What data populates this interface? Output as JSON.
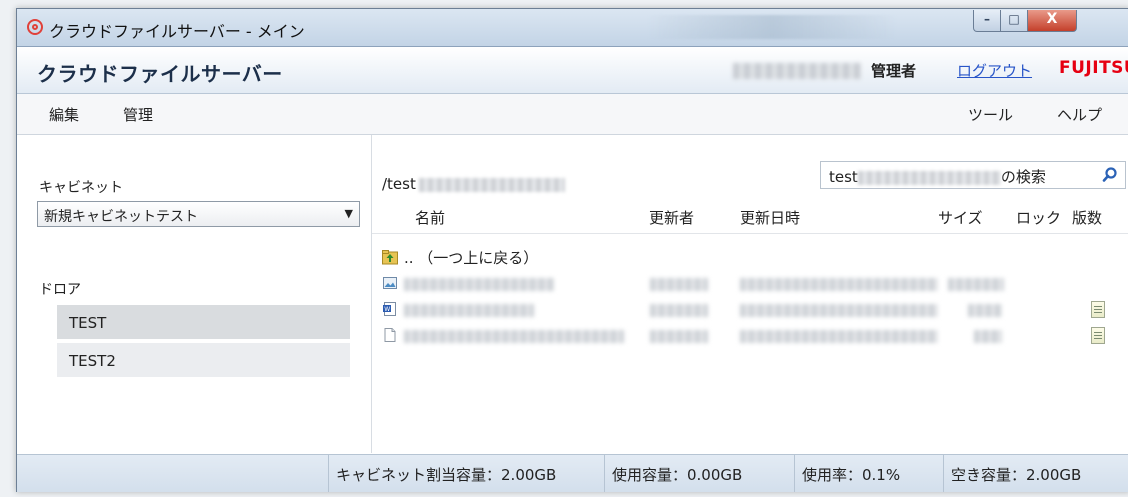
{
  "window": {
    "title": "クラウドファイルサーバー - メイン",
    "minimize": "–",
    "maximize": "□",
    "close": "X"
  },
  "header": {
    "app_name": "クラウドファイルサーバー",
    "role": "管理者",
    "logout": "ログアウト",
    "brand": "FUJITSU"
  },
  "menu": {
    "left": [
      "編集",
      "管理"
    ],
    "right": [
      "ツール",
      "ヘルプ"
    ]
  },
  "sidebar": {
    "cabinet_label": "キャビネット",
    "cabinet_selected": "新規キャビネットテスト",
    "drawer_label": "ドロア",
    "drawers": [
      "TEST",
      "TEST2"
    ]
  },
  "main": {
    "path": "/test",
    "search_prefix": "test",
    "search_suffix": "の検索",
    "columns": {
      "name": "名前",
      "updater": "更新者",
      "updated": "更新日時",
      "size": "サイズ",
      "lock": "ロック",
      "version": "版数"
    },
    "parent_row": ".. （一つ上に戻る）"
  },
  "status": {
    "quota": "キャビネット割当容量：2.00GB",
    "used": "使用容量：0.00GB",
    "usage": "使用率：0.1%",
    "free": "空き容量：2.00GB"
  },
  "icons": {
    "app": "cloud-loop-icon",
    "search": "search-icon",
    "up": "folder-up-icon"
  }
}
